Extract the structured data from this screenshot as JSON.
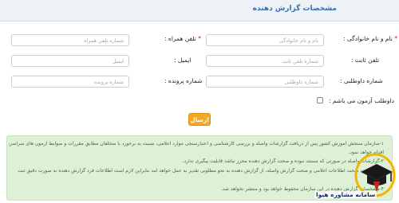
{
  "header": {
    "title": "مشخصات گزارش دهنده"
  },
  "form": {
    "full_name": {
      "label": "نام و نام خانوادگی :",
      "placeholder": "نام و نام خانوادگی"
    },
    "mobile": {
      "label": "تلفن همراه :",
      "placeholder": "شماره تلفن همراه"
    },
    "landline": {
      "label": "تلفن ثابت :",
      "placeholder": "شماره تلفن ثابت"
    },
    "email": {
      "label": "ایمیل :",
      "placeholder": "ایمیل"
    },
    "volunteer_number": {
      "label": "شماره داوطلبی :",
      "placeholder": "شماره داوطلبی"
    },
    "file_number": {
      "label": "شماره پرونده :",
      "placeholder": "شماره پرونده"
    },
    "is_candidate": {
      "label": "داوطلب آزمون می باشم :",
      "checked": false
    },
    "submit_label": "ارسال"
  },
  "notes": [
    "۱-سازمان سنجش آموزش کشور پس از دریافت گزارشات واصله و بررسی کارشناسی و اعتبارسنجی موارد اعلامی، نسبت به برخورد با متخلفان مطابق مقررات و ضوابط آزمون های سراسری",
    "اقدام خواهد نمود.",
    "۲-گزارشات واصله در صورتی که مستند نبوده و صحت گزارش دهنده محرز نباشد قابلیت پیگیری ندارد.",
    "۳-در صورت صحت اطلاعات اعلامی و صحت گزارش واصله، از گزارش دهنده به نحو مطلوبی تقدیر به عمل خواهد آمد بنابراین لازم است اطلاعات فرد گزارش دهنده به صورت دقیق ثبت",
    "شود.",
    "۴-مشخصات گزارش دهنده در این سازمان محفوظ خواهد بود و منتشر نخواهد شد."
  ],
  "watermark": {
    "text": "سامانه مشاوره هیوا"
  },
  "colors": {
    "accent": "#f5a623",
    "notes_bg": "#dff0d8",
    "header_title": "#3a6ca8",
    "required": "#d0021b"
  }
}
